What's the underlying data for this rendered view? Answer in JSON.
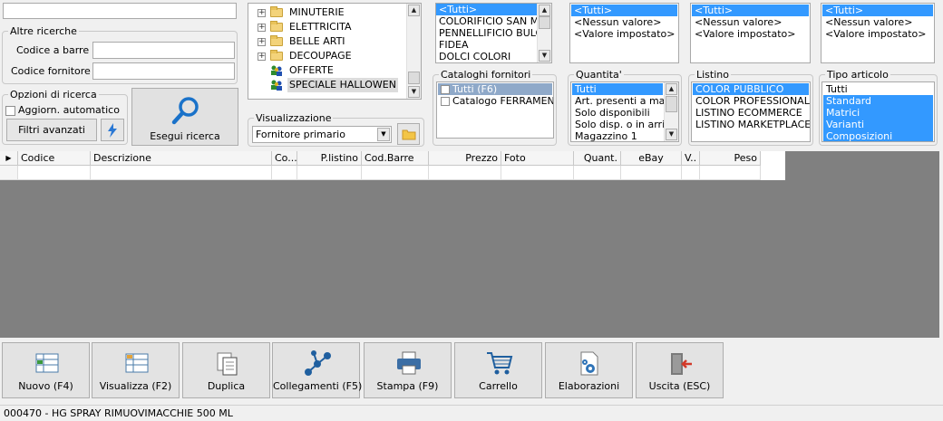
{
  "search": {
    "top_field_value": "",
    "altre_ricerche_label": "Altre ricerche",
    "codice_barre_label": "Codice a barre :",
    "codice_barre_value": "",
    "codice_fornitore_label": "Codice fornitore :",
    "codice_fornitore_value": "",
    "opzioni_label": "Opzioni di ricerca",
    "aggiorn_label": "Aggiorn. automatico",
    "filtri_label": "Filtri avanzati",
    "esegui_label": "Esegui ricerca"
  },
  "tree": {
    "items": [
      {
        "label": "MINUTERIE",
        "icon": "folder-icon"
      },
      {
        "label": "ELETTRICITA",
        "icon": "folder-icon"
      },
      {
        "label": "BELLE ARTI",
        "icon": "folder-icon"
      },
      {
        "label": "DECOUPAGE",
        "icon": "folder-icon"
      },
      {
        "label": "OFFERTE",
        "icon": "people-icon"
      },
      {
        "label": "SPECIALE HALLOWEN",
        "icon": "people-icon"
      }
    ]
  },
  "visualizzazione": {
    "label": "Visualizzazione",
    "selected": "Fornitore primario"
  },
  "fornitori": {
    "items": [
      "<Tutti>",
      "COLORIFICIO SAN MA",
      "PENNELLIFICIO BULO",
      "FIDEA",
      "DOLCI COLORI"
    ]
  },
  "filter_top": {
    "col1": [
      "<Tutti>",
      "<Nessun valore>",
      "<Valore impostato>"
    ],
    "col2": [
      "<Tutti>",
      "<Nessun valore>",
      "<Valore impostato>"
    ],
    "col3": [
      "<Tutti>",
      "<Nessun valore>",
      "<Valore impostato>"
    ]
  },
  "cataloghi": {
    "label": "Cataloghi fornitori",
    "items": [
      "Tutti (F6)",
      "Catalogo FERRAMENTA"
    ]
  },
  "quantita": {
    "label": "Quantita'",
    "items": [
      "Tutti",
      "Art. presenti a magazzino",
      "Solo disponibili",
      "Solo disp. o in arrivo",
      "Magazzino 1"
    ]
  },
  "listino": {
    "label": "Listino",
    "items": [
      "COLOR PUBBLICO",
      "COLOR PROFESSIONAL",
      "LISTINO ECOMMERCE",
      "LISTINO MARKETPLACE"
    ]
  },
  "tipo_articolo": {
    "label": "Tipo articolo",
    "items": [
      "Tutti",
      "Standard",
      "Matrici",
      "Varianti",
      "Composizioni"
    ]
  },
  "grid": {
    "columns": [
      "Codice",
      "Descrizione",
      "Co...",
      "P.listino",
      "Cod.Barre",
      "Prezzo",
      "Foto",
      "Quant.",
      "eBay",
      "V..",
      "Peso"
    ]
  },
  "toolbar": {
    "nuovo": "Nuovo (F4)",
    "visualizza": "Visualizza (F2)",
    "duplica": "Duplica",
    "collegamenti": "Collegamenti (F5)",
    "stampa": "Stampa (F9)",
    "carrello": "Carrello",
    "elaborazioni": "Elaborazioni",
    "uscita": "Uscita (ESC)"
  },
  "status": {
    "text": "000470 - HG SPRAY RIMUOVIMACCHIE 500 ML"
  },
  "colors": {
    "selection": "#3399ff",
    "grid_area": "#808080",
    "search_icon": "#1a72c9"
  }
}
